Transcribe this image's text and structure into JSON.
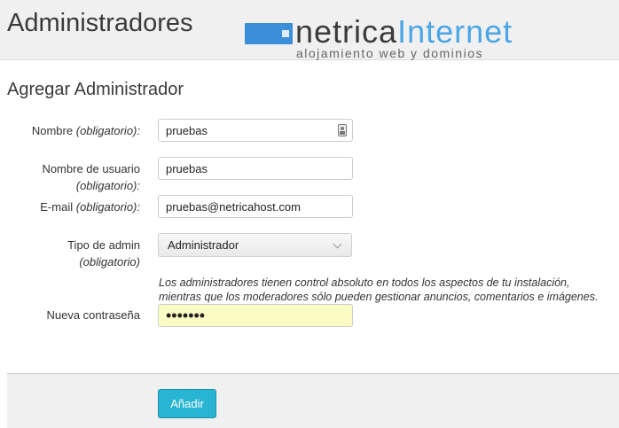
{
  "header": {
    "title": "Administradores",
    "logo": {
      "part1": "netrica",
      "part2": "Internet",
      "tagline": "alojamiento web y dominios"
    }
  },
  "form": {
    "title": "Agregar Administrador",
    "name_label": "Nombre",
    "name_required": "(obligatorio):",
    "name_value": "pruebas",
    "username_label": "Nombre de usuario",
    "username_required": "(obligatorio):",
    "username_value": "pruebas",
    "email_label": "E-mail",
    "email_required": "(obligatorio):",
    "email_value": "pruebas@netricahost.com",
    "type_label": "Tipo de admin",
    "type_required": "(obligatorio)",
    "type_value": "Administrador",
    "help_line1": "Los administradores tienen control absoluto en todos los aspectos de tu instalación,",
    "help_line2": "mientras que los moderadores sólo pueden gestionar anuncios, comentarios e imágenes.",
    "password_label": "Nueva contraseña",
    "password_value": "•••••••",
    "submit_label": "Añadir"
  },
  "colors": {
    "accent": "#28b5d3",
    "logo_blue": "#3b8ed8",
    "password_bg": "#fbfbc4"
  },
  "icons": {
    "name_field_icon": "contact-card-icon",
    "select_icon": "chevron-down-icon"
  }
}
